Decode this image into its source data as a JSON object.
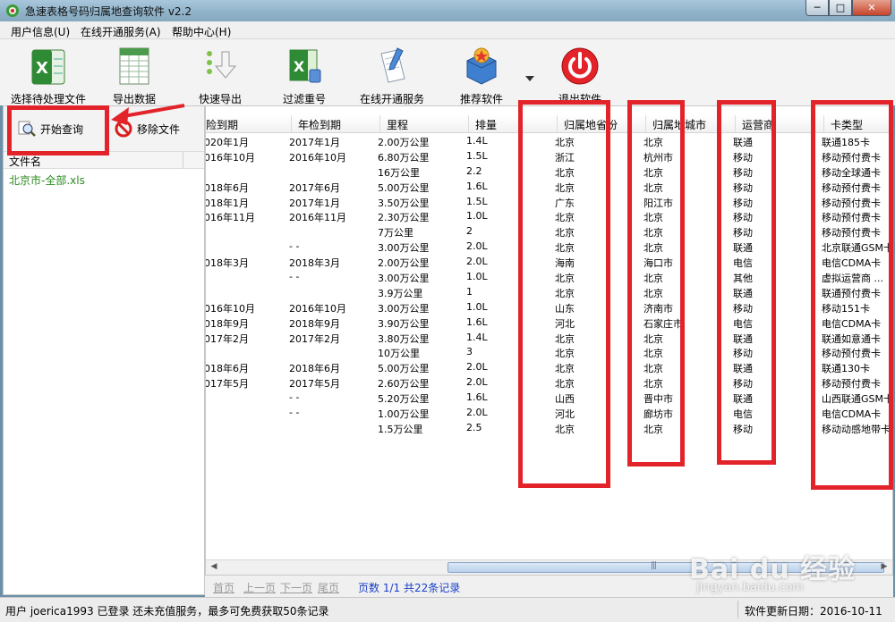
{
  "window": {
    "title": "急速表格号码归属地查询软件 v2.2",
    "min": "─",
    "max": "□",
    "close": "✕"
  },
  "menu": [
    "用户信息(U)",
    "在线开通服务(A)",
    "帮助中心(H)"
  ],
  "toolbar": {
    "select_file": "选择待处理文件",
    "export": "导出数据",
    "quick_export": "快速导出",
    "filter_dup": "过滤重号",
    "online_service": "在线开通服务",
    "recommend": "推荐软件",
    "exit": "退出软件"
  },
  "side": {
    "start_query": "开始查询",
    "remove_file": "移除文件",
    "file_header": "文件名",
    "files": [
      "北京市-全部.xls"
    ]
  },
  "grid": {
    "columns": [
      "保险到期",
      "年检到期",
      "里程",
      "排量",
      "归属地省份",
      "归属地城市",
      "运营商",
      "卡类型"
    ],
    "column_display": [
      "险到期",
      "年检到期",
      "里程",
      "排量",
      "归属地省份",
      "归属地城市",
      "运营商",
      "卡类型"
    ],
    "rows": [
      [
        "2020年1月",
        "2017年1月",
        "2.00万公里",
        "1.4L",
        "北京",
        "北京",
        "联通",
        "联通185卡"
      ],
      [
        "2016年10月",
        "2016年10月",
        "6.80万公里",
        "1.5L",
        "浙江",
        "杭州市",
        "移动",
        "移动预付费卡"
      ],
      [
        "",
        "",
        "16万公里",
        "2.2",
        "北京",
        "北京",
        "移动",
        "移动全球通卡"
      ],
      [
        "2018年6月",
        "2017年6月",
        "5.00万公里",
        "1.6L",
        "北京",
        "北京",
        "移动",
        "移动预付费卡"
      ],
      [
        "2018年1月",
        "2017年1月",
        "3.50万公里",
        "1.5L",
        "广东",
        "阳江市",
        "移动",
        "移动预付费卡"
      ],
      [
        "2016年11月",
        "2016年11月",
        "2.30万公里",
        "1.0L",
        "北京",
        "北京",
        "移动",
        "移动预付费卡"
      ],
      [
        "",
        "",
        "7万公里",
        "2",
        "北京",
        "北京",
        "移动",
        "移动预付费卡"
      ],
      [
        "-",
        "- -",
        "3.00万公里",
        "2.0L",
        "北京",
        "北京",
        "联通",
        "北京联通GSM卡"
      ],
      [
        "2018年3月",
        "2018年3月",
        "2.00万公里",
        "2.0L",
        "海南",
        "海口市",
        "电信",
        "电信CDMA卡"
      ],
      [
        "-",
        "- -",
        "3.00万公里",
        "1.0L",
        "北京",
        "北京",
        "其他",
        "虚拟运营商 ..."
      ],
      [
        "",
        "",
        "3.9万公里",
        "1",
        "北京",
        "北京",
        "联通",
        "联通预付费卡"
      ],
      [
        "2016年10月",
        "2016年10月",
        "3.00万公里",
        "1.0L",
        "山东",
        "济南市",
        "移动",
        "移动151卡"
      ],
      [
        "2018年9月",
        "2018年9月",
        "3.90万公里",
        "1.6L",
        "河北",
        "石家庄市",
        "电信",
        "电信CDMA卡"
      ],
      [
        "2017年2月",
        "2017年2月",
        "3.80万公里",
        "1.4L",
        "北京",
        "北京",
        "联通",
        "联通如意通卡"
      ],
      [
        "",
        "",
        "10万公里",
        "3",
        "北京",
        "北京",
        "移动",
        "移动预付费卡"
      ],
      [
        "2018年6月",
        "2018年6月",
        "5.00万公里",
        "2.0L",
        "北京",
        "北京",
        "联通",
        "联通130卡"
      ],
      [
        "2017年5月",
        "2017年5月",
        "2.60万公里",
        "2.0L",
        "北京",
        "北京",
        "移动",
        "移动预付费卡"
      ],
      [
        "-",
        "- -",
        "5.20万公里",
        "1.6L",
        "山西",
        "晋中市",
        "联通",
        "山西联通GSM卡"
      ],
      [
        "-",
        "- -",
        "1.00万公里",
        "2.0L",
        "河北",
        "廊坊市",
        "电信",
        "电信CDMA卡"
      ],
      [
        "",
        "",
        "1.5万公里",
        "2.5",
        "北京",
        "北京",
        "移动",
        "移动动感地带卡"
      ]
    ]
  },
  "pager": {
    "first": "首页",
    "prev": "上一页",
    "next": "下一页",
    "last": "尾页",
    "info": "页数 1/1 共22条记录"
  },
  "status": {
    "user": "用户 joerica1993 已登录 还未充值服务，最多可免费获取50条记录",
    "update": "软件更新日期：2016-10-11"
  },
  "watermark": {
    "brand": "Bai du 经验",
    "url": "jingyan.baidu.com"
  },
  "colors": {
    "annotation_red": "#e3232a",
    "file_green": "#2b8a1f",
    "pager_blue": "#1a40c8"
  }
}
